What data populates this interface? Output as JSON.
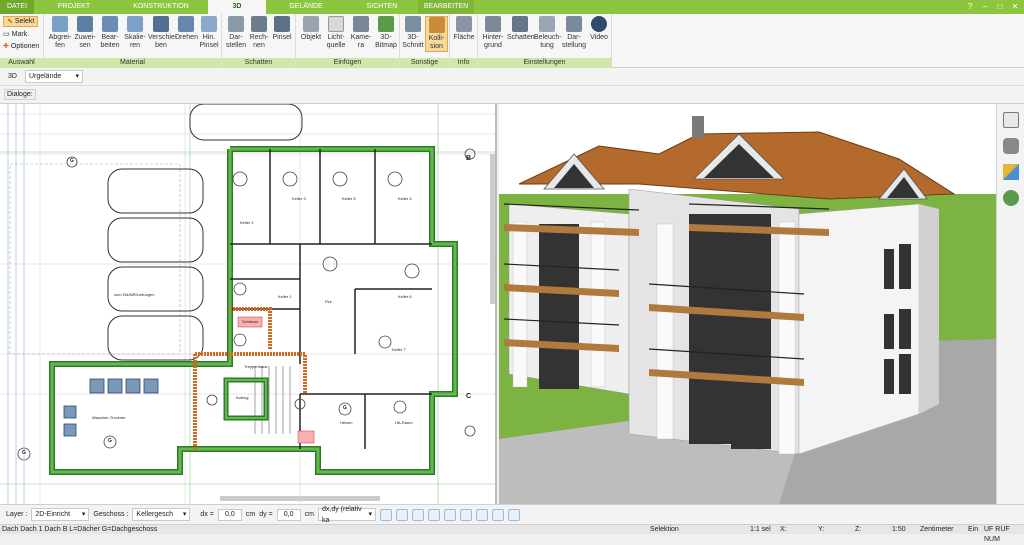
{
  "tabs": [
    "DATEI",
    "PROJEKT",
    "KONSTRUKTION",
    "3D",
    "GELÄNDE",
    "SICHTEN",
    "BEARBEITEN"
  ],
  "window_controls": [
    "?",
    "–",
    "□",
    "✕"
  ],
  "ribbon": {
    "auswahl": {
      "label": "Auswahl",
      "items": [
        "Selekt",
        "Mark.",
        "Optionen"
      ]
    },
    "material": {
      "label": "Material",
      "tools": [
        "Abgrei-\nfen",
        "Zuwei-\nsen",
        "Bear-\nbeiten",
        "Skalie-\nren",
        "Verschie-\nben",
        "Drehen",
        "Hin.\nPinsel"
      ]
    },
    "schatten": {
      "label": "Schatten",
      "tools": [
        "Dar-\nstellen",
        "Rech-\nnen",
        "Pinsel"
      ]
    },
    "einfuegen": {
      "label": "Einfügen",
      "tools": [
        "Objekt",
        "Licht-\nquelle",
        "Kame-\nra",
        "3D-\nBitmap"
      ]
    },
    "sonstige": {
      "label": "Sonstige",
      "tools": [
        "3D-\nSchnitt",
        "Kolli-\nsion"
      ]
    },
    "info": {
      "label": "Info",
      "tools": [
        "Fläche"
      ]
    },
    "einstellungen": {
      "label": "Einstellungen",
      "tools": [
        "Hinter-\ngrund",
        "Schatten",
        "Beleuch-\ntung",
        "Dar-\nstellung",
        "Video"
      ]
    }
  },
  "row2": {
    "view_label": "3D",
    "terrain": "Urgelände"
  },
  "row3": {
    "dialogs_label": "Dialoge:"
  },
  "plan_labels": {
    "keller2": "Keller 2",
    "keller3": "Keller 3",
    "keller4": "Keller 4",
    "keller5": "Keller 5",
    "keller6": "Keller 6",
    "keller7": "Keller 7",
    "keller1": "Keller 1",
    "flur": "Flur",
    "schleuse": "Schleuse",
    "treppenhaus": "Treppenhaus",
    "aufzug": "Aufzug",
    "heizen": "Heizen",
    "haraum": "HA-Raum",
    "waschen": "Waschen-Trockner",
    "entwaesserung": "zum DN/MR/Leitungen",
    "axis_b": "B",
    "axis_c": "C",
    "g": "G"
  },
  "bottom": {
    "layer_label": "Layer :",
    "layer_value": "2D-Einricht",
    "geschoss_label": "Geschoss :",
    "geschoss_value": "Kellergesch",
    "dx_label": "dx =",
    "dx_value": "0,0",
    "dy_label": "dy =",
    "dy_value": "0,0",
    "unit": "cm",
    "mode": "dx,dy (relativ ka"
  },
  "status": {
    "layers": "Dach Dach 1 Dach B L=Dächer G=Dachgeschoss",
    "selection": "Selektion",
    "scale_sel": "1:1 sel",
    "x": "X:",
    "y": "Y:",
    "z": "Z:",
    "scale": "1:50",
    "unit": "Zentimeter",
    "ein": "Ein",
    "flags": "UF RUF NUM"
  },
  "colors": {
    "accent": "#8cc63f",
    "ribbon_group": "#cfe8a9",
    "roof": "#b36a2c",
    "wall": "#f0f0f0",
    "grass": "#7cb342"
  }
}
